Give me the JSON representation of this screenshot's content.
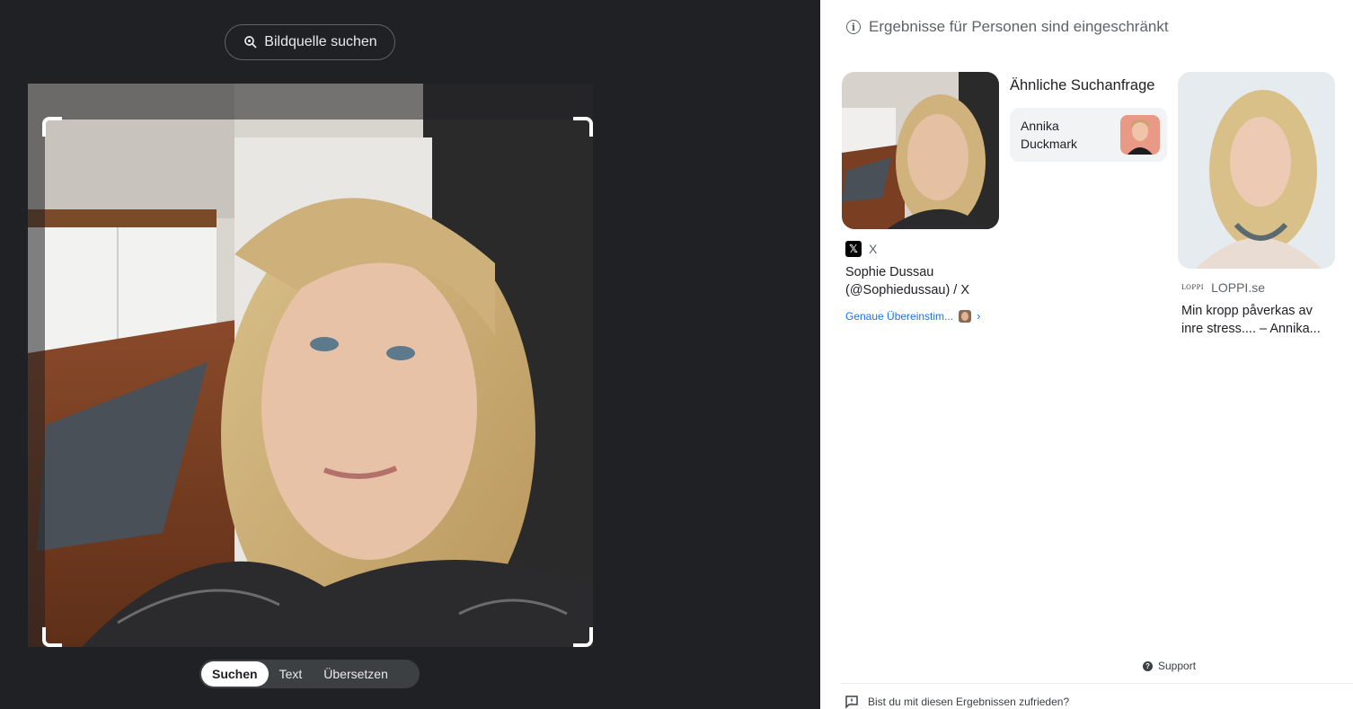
{
  "left": {
    "source_button": {
      "label": "Bildquelle suchen",
      "icon": "lens-search-icon"
    },
    "modes": [
      {
        "label": "Suchen",
        "active": true
      },
      {
        "label": "Text",
        "active": false
      },
      {
        "label": "Übersetzen",
        "active": false
      }
    ]
  },
  "right": {
    "notice": {
      "icon": "info-icon",
      "text": "Ergebnisse für Personen sind eingeschränkt"
    },
    "results": [
      {
        "source_name": "X",
        "title": "Sophie Dussau (@Sophiedussau) / X",
        "match_link": "Genaue Übereinstim..."
      },
      {
        "source_name": "LOPPI.se",
        "source_logo": "LOPPI",
        "title": "Min kropp påverkas av inre stress.... – Annika..."
      }
    ],
    "similar": {
      "title": "Ähnliche Suchanfrage",
      "chip_label": "Annika Duckmark"
    },
    "footer": {
      "support": "Support",
      "feedback": "Bist du mit diesen Ergebnissen zufrieden?"
    }
  },
  "colors": {
    "dark_bg": "#202124",
    "link_blue": "#1a73e8",
    "chip_bg": "#f1f3f4"
  }
}
